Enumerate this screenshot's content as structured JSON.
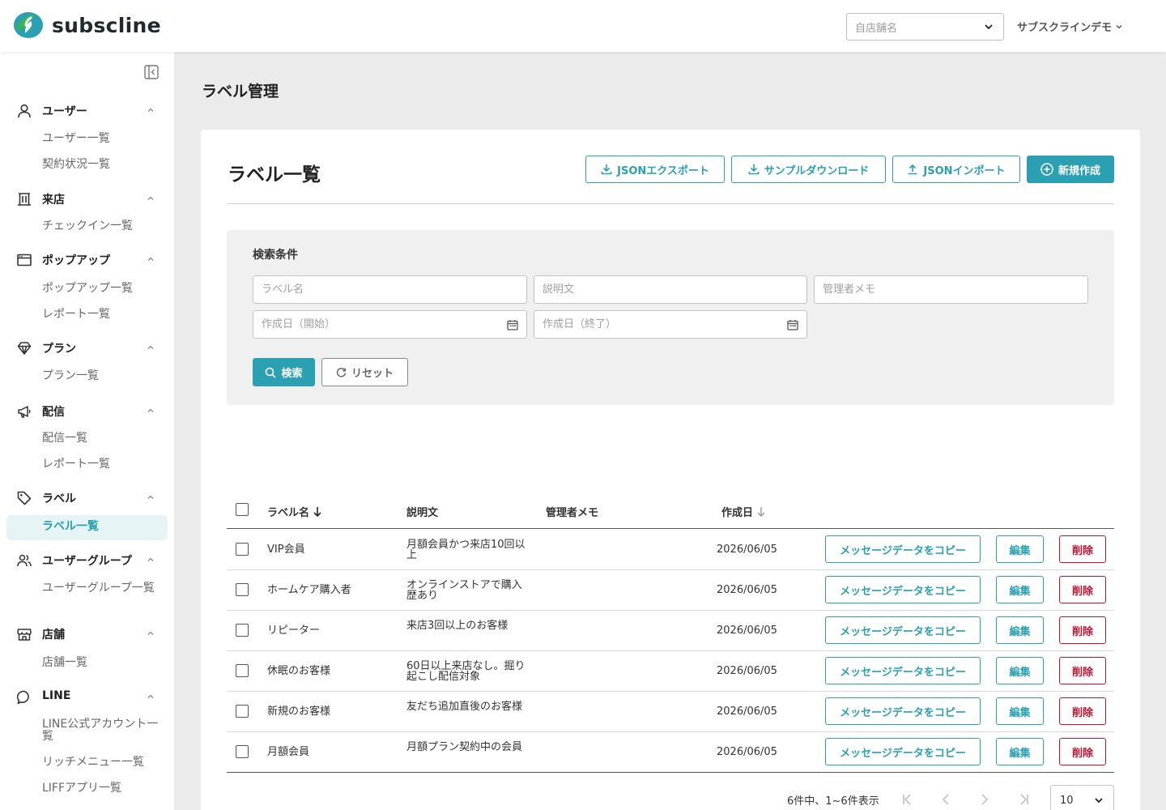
{
  "brand": {
    "name": "subscline",
    "colors": {
      "accent": "#2aa0b2",
      "danger": "#c8102e",
      "logo_green": "#3fb34f",
      "logo_teal": "#2aa0b2"
    }
  },
  "header": {
    "store_placeholder": "自店舗名",
    "account_name": "サブスクラインデモ"
  },
  "sidebar": {
    "groups": [
      {
        "label": "ユーザー",
        "icon": "user-icon",
        "items": [
          "ユーザー一覧",
          "契約状況一覧"
        ]
      },
      {
        "label": "来店",
        "icon": "building-icon",
        "items": [
          "チェックイン一覧"
        ]
      },
      {
        "label": "ポップアップ",
        "icon": "window-icon",
        "items": [
          "ポップアップ一覧",
          "レポート一覧"
        ]
      },
      {
        "label": "プラン",
        "icon": "diamond-icon",
        "items": [
          "プラン一覧"
        ]
      },
      {
        "label": "配信",
        "icon": "megaphone-icon",
        "items": [
          "配信一覧",
          "レポート一覧"
        ]
      },
      {
        "label": "ラベル",
        "icon": "tag-icon",
        "items": [
          "ラベル一覧"
        ]
      },
      {
        "label": "ユーザーグループ",
        "icon": "users-icon",
        "items": [
          "ユーザーグループ一覧"
        ]
      },
      {
        "label": "店舗",
        "icon": "store-icon",
        "items": [
          "店舗一覧"
        ]
      },
      {
        "label": "LINE",
        "icon": "chat-icon",
        "items": [
          "LINE公式アカウント一覧",
          "リッチメニュー一覧",
          "LIFFアプリ一覧"
        ]
      }
    ],
    "active_item": "ラベル一覧"
  },
  "page": {
    "title": "ラベル管理"
  },
  "card": {
    "title": "ラベル一覧",
    "buttons": {
      "json_export": "JSONエクスポート",
      "sample_download": "サンプルダウンロード",
      "json_import": "JSONインポート",
      "create": "新規作成"
    }
  },
  "search": {
    "title": "検索条件",
    "placeholders": {
      "label_name": "ラベル名",
      "description": "説明文",
      "admin_memo": "管理者メモ",
      "date_start": "作成日（開始）",
      "date_end": "作成日（終了）"
    },
    "search_button": "検索",
    "reset_button": "リセット"
  },
  "table": {
    "columns": {
      "label_name": "ラベル名",
      "description": "説明文",
      "admin_memo": "管理者メモ",
      "created": "作成日"
    },
    "rows": [
      {
        "name": "VIP会員",
        "description": "月額会員かつ来店10回以上",
        "memo": "",
        "created": "2026/06/05"
      },
      {
        "name": "ホームケア購入者",
        "description": "オンラインストアで購入歴あり",
        "memo": "",
        "created": "2026/06/05"
      },
      {
        "name": "リピーター",
        "description": "来店3回以上のお客様",
        "memo": "",
        "created": "2026/06/05"
      },
      {
        "name": "休眠のお客様",
        "description": "60日以上来店なし。掘り起こし配信対象",
        "memo": "",
        "created": "2026/06/05"
      },
      {
        "name": "新規のお客様",
        "description": "友だち追加直後のお客様",
        "memo": "",
        "created": "2026/06/05"
      },
      {
        "name": "月額会員",
        "description": "月額プラン契約中の会員",
        "memo": "",
        "created": "2026/06/05"
      }
    ],
    "row_actions": {
      "copy": "メッセージデータをコピー",
      "edit": "編集",
      "delete": "削除"
    }
  },
  "pagination": {
    "summary": "6件中、1~6件表示",
    "page_size": "10"
  }
}
